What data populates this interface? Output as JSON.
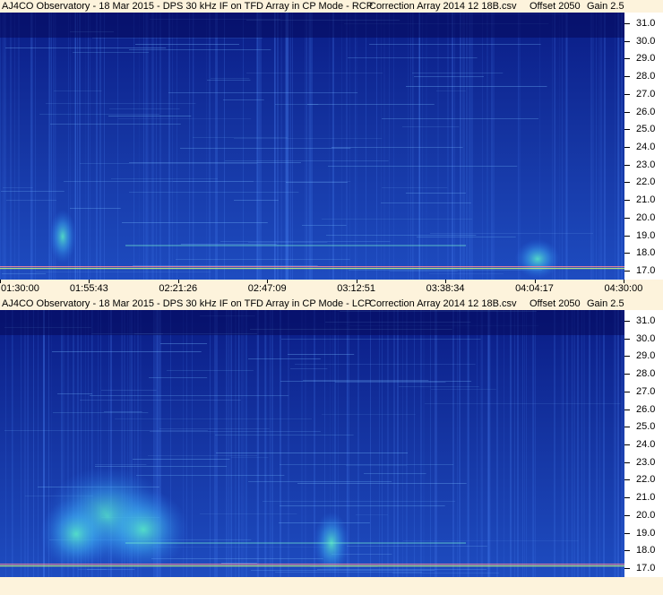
{
  "chart_data": [
    {
      "type": "heatmap",
      "title": "AJ4CO Observatory - 18 Mar 2015 - DPS 30 kHz IF on TFD Array in CP Mode - RCP",
      "correction": "Correction Array 2014 12 18B.csv",
      "offset": "Offset 2050",
      "gain": "Gain 2.5",
      "y_ticks": [
        "31.0",
        "30.0",
        "29.0",
        "28.0",
        "27.0",
        "26.0",
        "25.0",
        "24.0",
        "23.0",
        "22.0",
        "21.0",
        "20.0",
        "19.0",
        "18.0",
        "17.0"
      ],
      "x_ticks": [
        "01:30:00",
        "01:55:43",
        "02:21:26",
        "02:47:09",
        "03:12:51",
        "03:38:34",
        "04:04:17",
        "04:30:00"
      ],
      "ylim": [
        16.5,
        31.6
      ],
      "colors": {
        "background": "#1a3aa8",
        "low": "#0c1f8c",
        "high": "#4ff0c0"
      }
    },
    {
      "type": "heatmap",
      "title": "AJ4CO Observatory - 18 Mar 2015 - DPS 30 kHz IF on TFD Array in CP Mode - LCP",
      "correction": "Correction Array 2014 12 18B.csv",
      "offset": "Offset 2050",
      "gain": "Gain 2.5",
      "y_ticks": [
        "31.0",
        "30.0",
        "29.0",
        "28.0",
        "27.0",
        "26.0",
        "25.0",
        "24.0",
        "23.0",
        "22.0",
        "21.0",
        "20.0",
        "19.0",
        "18.0",
        "17.0"
      ],
      "x_ticks": [],
      "ylim": [
        16.5,
        31.6
      ],
      "colors": {
        "background": "#1a3aa8",
        "low": "#0c1f8c",
        "high": "#4ff0c0"
      }
    }
  ]
}
